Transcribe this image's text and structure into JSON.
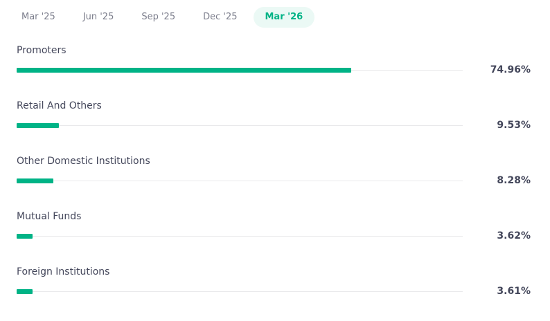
{
  "tabs": [
    {
      "label": "Mar '25",
      "active": false
    },
    {
      "label": "Jun '25",
      "active": false
    },
    {
      "label": "Sep '25",
      "active": false
    },
    {
      "label": "Dec '25",
      "active": false
    },
    {
      "label": "Mar '26",
      "active": true
    }
  ],
  "accent_color": "#00b386",
  "holdings": [
    {
      "label": "Promoters",
      "value_text": "74.96%",
      "percent": 74.96
    },
    {
      "label": "Retail And Others",
      "value_text": "9.53%",
      "percent": 9.53
    },
    {
      "label": "Other Domestic Institutions",
      "value_text": "8.28%",
      "percent": 8.28
    },
    {
      "label": "Mutual Funds",
      "value_text": "3.62%",
      "percent": 3.62
    },
    {
      "label": "Foreign Institutions",
      "value_text": "3.61%",
      "percent": 3.61
    }
  ]
}
